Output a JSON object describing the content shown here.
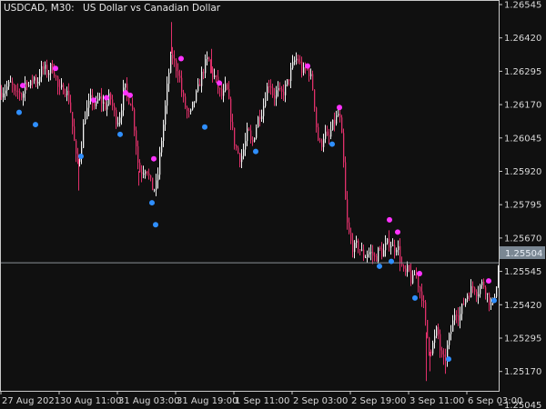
{
  "title": {
    "symbol_timeframe": "USDCAD, M30:",
    "description": "US Dollar vs Canadian Dollar"
  },
  "current_price": "1.25504",
  "colors": {
    "background": "#101010",
    "frame": "#c8c8c8",
    "bullish_candle": "#f2f2f2",
    "bearish_candle": "#e0306a",
    "hh_dot": "#ff33ff",
    "ll_dot": "#2f8fff",
    "price_line": "#8a8f96",
    "price_badge": "#7a8793"
  },
  "chart_data": {
    "type": "candlestick",
    "symbol": "USDCAD",
    "timeframe": "M30",
    "y_ticks": [
      "1.26545",
      "1.26420",
      "1.26295",
      "1.26170",
      "1.26045",
      "1.25920",
      "1.25795",
      "1.25670",
      "1.25545",
      "1.25420",
      "1.25295",
      "1.25170",
      "1.25045"
    ],
    "x_ticks": [
      "27 Aug 2021",
      "30 Aug 11:00",
      "31 Aug 03:00",
      "31 Aug 19:00",
      "1 Sep 11:00",
      "2 Sep 03:00",
      "2 Sep 19:00",
      "3 Sep 11:00",
      "6 Sep 03:00"
    ],
    "ylim": [
      1.2498,
      1.2658
    ],
    "close_path": [
      [
        0,
        1.262
      ],
      [
        6,
        1.2622
      ],
      [
        12,
        1.2624
      ],
      [
        16,
        1.2618
      ],
      [
        20,
        1.2621
      ],
      [
        24,
        1.2618
      ],
      [
        28,
        1.2626
      ],
      [
        32,
        1.2622
      ],
      [
        36,
        1.2627
      ],
      [
        40,
        1.2624
      ],
      [
        44,
        1.2629
      ],
      [
        48,
        1.263
      ],
      [
        52,
        1.2628
      ],
      [
        56,
        1.2631
      ],
      [
        60,
        1.2628
      ],
      [
        64,
        1.262
      ],
      [
        68,
        1.2622
      ],
      [
        72,
        1.2621
      ],
      [
        76,
        1.2616
      ],
      [
        80,
        1.2603
      ],
      [
        84,
        1.259
      ],
      [
        88,
        1.2596
      ],
      [
        92,
        1.261
      ],
      [
        96,
        1.2614
      ],
      [
        100,
        1.2618
      ],
      [
        104,
        1.2614
      ],
      [
        108,
        1.2618
      ],
      [
        112,
        1.2616
      ],
      [
        116,
        1.2614
      ],
      [
        120,
        1.2619
      ],
      [
        124,
        1.2613
      ],
      [
        128,
        1.2608
      ],
      [
        132,
        1.2612
      ],
      [
        136,
        1.2623
      ],
      [
        140,
        1.2618
      ],
      [
        144,
        1.2616
      ],
      [
        148,
        1.2603
      ],
      [
        152,
        1.2588
      ],
      [
        156,
        1.2588
      ],
      [
        160,
        1.259
      ],
      [
        164,
        1.2584
      ],
      [
        168,
        1.258
      ],
      [
        172,
        1.2583
      ],
      [
        176,
        1.2598
      ],
      [
        180,
        1.261
      ],
      [
        184,
        1.2626
      ],
      [
        188,
        1.2636
      ],
      [
        192,
        1.2631
      ],
      [
        196,
        1.2628
      ],
      [
        200,
        1.2618
      ],
      [
        204,
        1.2613
      ],
      [
        208,
        1.261
      ],
      [
        212,
        1.2616
      ],
      [
        216,
        1.262
      ],
      [
        220,
        1.2626
      ],
      [
        224,
        1.2631
      ],
      [
        228,
        1.2634
      ],
      [
        232,
        1.2628
      ],
      [
        236,
        1.2626
      ],
      [
        240,
        1.2621
      ],
      [
        244,
        1.2618
      ],
      [
        248,
        1.2623
      ],
      [
        252,
        1.2613
      ],
      [
        256,
        1.2601
      ],
      [
        260,
        1.2596
      ],
      [
        264,
        1.2593
      ],
      [
        268,
        1.2598
      ],
      [
        272,
        1.2605
      ],
      [
        276,
        1.2598
      ],
      [
        280,
        1.2605
      ],
      [
        284,
        1.2611
      ],
      [
        288,
        1.2613
      ],
      [
        292,
        1.2621
      ],
      [
        296,
        1.2625
      ],
      [
        300,
        1.2618
      ],
      [
        304,
        1.2621
      ],
      [
        308,
        1.2619
      ],
      [
        312,
        1.2621
      ],
      [
        316,
        1.2625
      ],
      [
        320,
        1.263
      ],
      [
        324,
        1.2634
      ],
      [
        328,
        1.2633
      ],
      [
        332,
        1.2628
      ],
      [
        336,
        1.263
      ],
      [
        340,
        1.2628
      ],
      [
        344,
        1.262
      ],
      [
        348,
        1.2602
      ],
      [
        352,
        1.2598
      ],
      [
        356,
        1.2604
      ],
      [
        360,
        1.26
      ],
      [
        364,
        1.2606
      ],
      [
        368,
        1.2609
      ],
      [
        372,
        1.2612
      ],
      [
        376,
        1.2598
      ],
      [
        380,
        1.2568
      ],
      [
        384,
        1.256
      ],
      [
        388,
        1.2556
      ],
      [
        392,
        1.2558
      ],
      [
        396,
        1.2555
      ],
      [
        400,
        1.2553
      ],
      [
        404,
        1.2555
      ],
      [
        408,
        1.2554
      ],
      [
        412,
        1.2552
      ],
      [
        416,
        1.2556
      ],
      [
        420,
        1.2554
      ],
      [
        424,
        1.2558
      ],
      [
        428,
        1.2559
      ],
      [
        432,
        1.2556
      ],
      [
        436,
        1.2558
      ],
      [
        440,
        1.255
      ],
      [
        444,
        1.2545
      ],
      [
        448,
        1.2548
      ],
      [
        452,
        1.2542
      ],
      [
        456,
        1.2547
      ],
      [
        460,
        1.254
      ],
      [
        464,
        1.2536
      ],
      [
        468,
        1.2522
      ],
      [
        472,
        1.2514
      ],
      [
        476,
        1.2518
      ],
      [
        480,
        1.2524
      ],
      [
        484,
        1.2512
      ],
      [
        488,
        1.2509
      ],
      [
        492,
        1.2518
      ],
      [
        496,
        1.2524
      ],
      [
        500,
        1.2532
      ],
      [
        504,
        1.2528
      ],
      [
        508,
        1.2533
      ],
      [
        512,
        1.2537
      ],
      [
        516,
        1.2539
      ],
      [
        520,
        1.2541
      ],
      [
        524,
        1.2538
      ],
      [
        528,
        1.2542
      ],
      [
        532,
        1.2541
      ],
      [
        536,
        1.2536
      ],
      [
        540,
        1.2532
      ],
      [
        544,
        1.254
      ],
      [
        548,
        1.2548
      ]
    ],
    "upper_markers": [
      [
        25,
        1.2623
      ],
      [
        61,
        1.263
      ],
      [
        103,
        1.2617
      ],
      [
        117,
        1.2618
      ],
      [
        138,
        1.262
      ],
      [
        143,
        1.2619
      ],
      [
        169,
        1.2593
      ],
      [
        199,
        1.2634
      ],
      [
        241,
        1.2624
      ],
      [
        338,
        1.2631
      ],
      [
        373,
        1.2614
      ],
      [
        428,
        1.2568
      ],
      [
        437,
        1.2563
      ],
      [
        461,
        1.2546
      ],
      [
        537,
        1.2543
      ]
    ],
    "lower_markers": [
      [
        21,
        1.2612
      ],
      [
        39,
        1.2607
      ],
      [
        89,
        1.2594
      ],
      [
        132,
        1.2603
      ],
      [
        167,
        1.2575
      ],
      [
        171,
        1.2566
      ],
      [
        225,
        1.2606
      ],
      [
        281,
        1.2596
      ],
      [
        365,
        1.2599
      ],
      [
        417,
        1.2549
      ],
      [
        430,
        1.2551
      ],
      [
        456,
        1.2536
      ],
      [
        493,
        1.2511
      ],
      [
        543,
        1.2535
      ]
    ]
  }
}
